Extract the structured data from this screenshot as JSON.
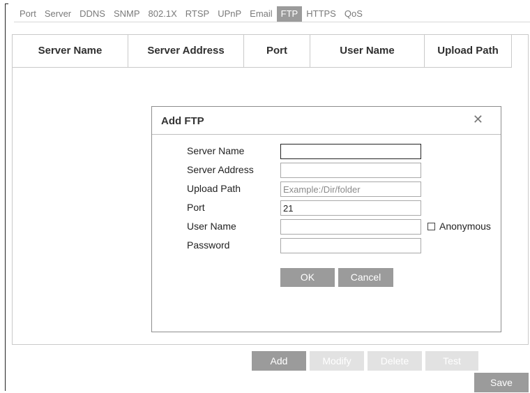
{
  "tabs": [
    {
      "label": "Port"
    },
    {
      "label": "Server"
    },
    {
      "label": "DDNS"
    },
    {
      "label": "SNMP"
    },
    {
      "label": "802.1X"
    },
    {
      "label": "RTSP"
    },
    {
      "label": "UPnP"
    },
    {
      "label": "Email"
    },
    {
      "label": "FTP",
      "active": true
    },
    {
      "label": "HTTPS"
    },
    {
      "label": "QoS"
    }
  ],
  "table": {
    "columns": [
      "Server Name",
      "Server Address",
      "Port",
      "User Name",
      "Upload Path"
    ],
    "rows": []
  },
  "dialog": {
    "title": "Add FTP",
    "close_icon": "close-icon",
    "fields": {
      "server_name": {
        "label": "Server Name",
        "value": ""
      },
      "server_address": {
        "label": "Server Address",
        "value": ""
      },
      "upload_path": {
        "label": "Upload Path",
        "value": "",
        "placeholder": "Example:/Dir/folder"
      },
      "port": {
        "label": "Port",
        "value": "21"
      },
      "user_name": {
        "label": "User Name",
        "value": ""
      },
      "password": {
        "label": "Password",
        "value": ""
      }
    },
    "anonymous": {
      "label": "Anonymous",
      "checked": false
    },
    "ok_label": "OK",
    "cancel_label": "Cancel"
  },
  "actions": {
    "add": "Add",
    "modify": "Modify",
    "delete": "Delete",
    "test": "Test",
    "save": "Save"
  },
  "colors": {
    "active_tab": "#9b9b9b",
    "button_enabled": "#9b9b9b",
    "button_disabled": "#e2e2e2"
  }
}
